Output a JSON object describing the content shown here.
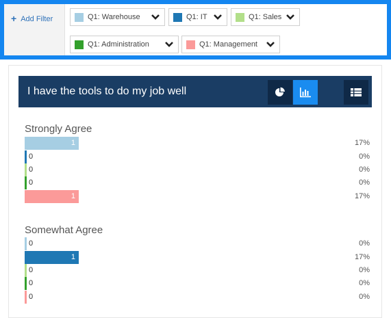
{
  "filters": {
    "add_label": "Add Filter",
    "chips": [
      {
        "label": "Q1: Warehouse",
        "color": "#a6cee3"
      },
      {
        "label": "Q1: IT",
        "color": "#1f78b4"
      },
      {
        "label": "Q1: Sales",
        "color": "#b2df8a"
      },
      {
        "label": "Q1: Administration",
        "color": "#33a02c"
      },
      {
        "label": "Q1: Management",
        "color": "#fb9a99"
      }
    ]
  },
  "panel": {
    "title": "I have the tools to do my job well",
    "buttons": [
      "pie-chart-icon",
      "bar-chart-icon",
      "table-icon"
    ]
  },
  "groups": [
    {
      "label": "Strongly Agree",
      "rows": [
        {
          "value": "1",
          "pct": "17%"
        },
        {
          "value": "0",
          "pct": "0%"
        },
        {
          "value": "0",
          "pct": "0%"
        },
        {
          "value": "0",
          "pct": "0%"
        },
        {
          "value": "1",
          "pct": "17%"
        }
      ]
    },
    {
      "label": "Somewhat Agree",
      "rows": [
        {
          "value": "0",
          "pct": "0%"
        },
        {
          "value": "1",
          "pct": "17%"
        },
        {
          "value": "0",
          "pct": "0%"
        },
        {
          "value": "0",
          "pct": "0%"
        },
        {
          "value": "0",
          "pct": "0%"
        }
      ]
    }
  ]
}
